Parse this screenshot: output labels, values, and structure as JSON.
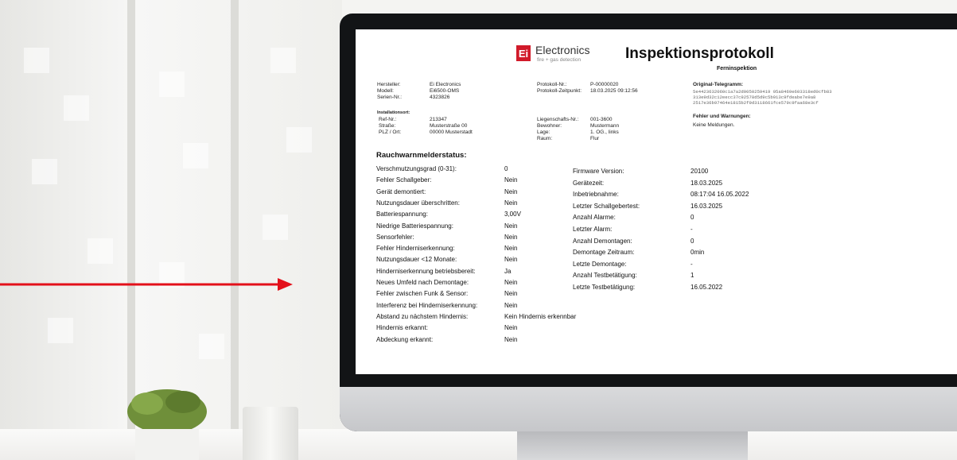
{
  "document": {
    "brand": "Electronics",
    "brand_mark": "Ei",
    "brand_tagline": "fire + gas detection",
    "title": "Inspektionsprotokoll",
    "subtitle": "Ferninspektion",
    "device_info": [
      {
        "label": "Hersteller:",
        "value": "Ei Electronics"
      },
      {
        "label": "Modell:",
        "value": "Ei6500-OMS"
      },
      {
        "label": "Serien-Nr.:",
        "value": "4323826"
      }
    ],
    "protocol_info": [
      {
        "label": "Protokoll-Nr.:",
        "value": "P-00000020"
      },
      {
        "label": "Protokoll-Zeitpunkt:",
        "value": "18.03.2025 09:12:56"
      }
    ],
    "telegram": {
      "label": "Original-Telegramm:",
      "lines": [
        "5e4423632060c1a7a2d0050259419 95a8469e603318ed0cfb83",
        "313e9d32c12eecc37c92578d5d9c5b913c9fdeabe7e9a8",
        "2517e36b97464e1815b2f9d3118661fce579c9faa68e3cf"
      ]
    },
    "installation": {
      "heading": "Installationsort:",
      "left": [
        {
          "label": "Ref-Nr.:",
          "value": "213347"
        },
        {
          "label": "Straße:",
          "value": "Musterstraße 00"
        },
        {
          "label": "PLZ / Ort:",
          "value": "00000 Musterstadt"
        }
      ],
      "right": [
        {
          "label": "Liegenschafts-Nr.:",
          "value": "001-3600"
        },
        {
          "label": "Bewohner:",
          "value": "Mustermann"
        },
        {
          "label": "Lage:",
          "value": "1. OG., links"
        },
        {
          "label": "Raum:",
          "value": "Flur"
        }
      ]
    },
    "warnings": {
      "label": "Fehler und Warnungen:",
      "value": "Keine Meldungen."
    },
    "status_heading": "Rauchwarnmelderstatus:",
    "status_left": [
      {
        "label": "Verschmutzungsgrad (0-31):",
        "value": "0"
      },
      {
        "label": "Fehler Schallgeber:",
        "value": "Nein"
      },
      {
        "label": "Gerät demontiert:",
        "value": "Nein"
      },
      {
        "label": "Nutzungsdauer überschritten:",
        "value": "Nein"
      },
      {
        "label": "Batteriespannung:",
        "value": "3,00V"
      },
      {
        "label": "Niedrige Batteriespannung:",
        "value": "Nein"
      },
      {
        "label": "Sensorfehler:",
        "value": "Nein"
      },
      {
        "label": "Fehler Hinderniserkennung:",
        "value": "Nein"
      },
      {
        "label": "Nutzungsdauer <12 Monate:",
        "value": "Nein"
      },
      {
        "label": "Hinderniserkennung betriebsbereit:",
        "value": "Ja"
      },
      {
        "label": "Neues Umfeld nach Demontage:",
        "value": "Nein"
      },
      {
        "label": "Fehler zwischen Funk & Sensor:",
        "value": "Nein"
      },
      {
        "label": "Interferenz bei Hinderniserkennung:",
        "value": "Nein"
      },
      {
        "label": "Abstand zu nächstem Hindernis:",
        "value": "Kein Hindernis erkennbar"
      },
      {
        "label": "Hindernis erkannt:",
        "value": "Nein"
      },
      {
        "label": "Abdeckung erkannt:",
        "value": "Nein"
      }
    ],
    "status_right": [
      {
        "label": "Firmware Version:",
        "value": "20100"
      },
      {
        "label": "Gerätezeit:",
        "value": "18.03.2025"
      },
      {
        "label": "Inbetriebnahme:",
        "value": "08:17:04 16.05.2022"
      },
      {
        "label": "Letzter Schallgebertest:",
        "value": "16.03.2025"
      },
      {
        "label": "Anzahl Alarme:",
        "value": "0"
      },
      {
        "label": "Letzter Alarm:",
        "value": "-"
      },
      {
        "label": "Anzahl Demontagen:",
        "value": "0"
      },
      {
        "label": "Demontage Zeitraum:",
        "value": "0min"
      },
      {
        "label": "Letzte Demontage:",
        "value": "-"
      },
      {
        "label": "Anzahl Testbetätigung:",
        "value": "1"
      },
      {
        "label": "Letzte Testbetätigung:",
        "value": "16.05.2022"
      }
    ]
  },
  "colors": {
    "brand_red": "#d11a2a",
    "arrow_red": "#e3101a",
    "bezel": "#121416"
  }
}
